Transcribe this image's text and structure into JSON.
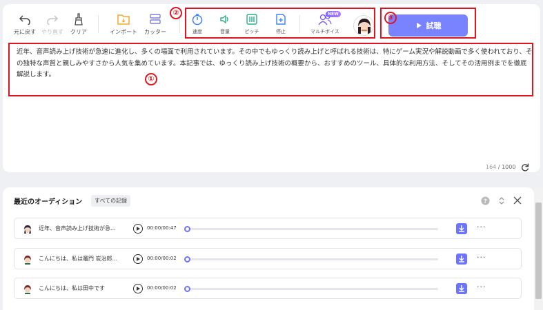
{
  "toolbar": {
    "undo": "元に戻す",
    "redo": "やり直す",
    "clear": "クリア",
    "import": "インポート",
    "cutter": "カッター",
    "speed": "速度",
    "volume": "音量",
    "pitch": "ピッチ",
    "pause": "停止",
    "multi_voice": "マルチボイス",
    "new_badge": "NEW",
    "try_button": "試聴"
  },
  "editor": {
    "text": "近年、音声読み上げ技術が急速に進化し、多くの場面で利用されています。その中でもゆっくり読み上げと呼ばれる技術は、特にゲーム実況や解説動画で多く使われており、その独特な声質と親しみやすさから人気を集めています。本記事では、ゆっくり読み上げ技術の概要から、おすすめのツール、具体的な利用方法、そしてその活用例までを徹底解説します。",
    "count": "164",
    "max": " / 1000"
  },
  "annotations": [
    "②",
    "③",
    "①",
    "④"
  ],
  "recent": {
    "title": "最近のオーディション",
    "all_records": "すべての記録",
    "rows": [
      {
        "text": "近年、音声読み上げ技術が急...",
        "time": "00:00/00:47",
        "progress": 0
      },
      {
        "text": "こんにちは、私は竈門 炭治郎...",
        "time": "00:00/00:02",
        "progress": 0
      },
      {
        "text": "こんにちは、私は田中です",
        "time": "00:00/00:02",
        "progress": 0
      }
    ]
  },
  "colors": {
    "accent": "#6b73ff",
    "annotation": "#e0141e",
    "import_icon": "#f5a623",
    "speed_icon": "#3b82f6",
    "volume_icon": "#22b07d",
    "pitch_icon": "#22b07d",
    "pause_icon": "#3b82f6",
    "multi_voice_icon": "#7c5cff"
  },
  "icons": [
    "undo-icon",
    "redo-icon",
    "broom-icon",
    "folder-import-icon",
    "cutter-icon",
    "speed-icon",
    "volume-icon",
    "pitch-icon",
    "pause-insert-icon",
    "multi-voice-icon",
    "avatar",
    "play-icon",
    "help-icon",
    "sort-icon",
    "close-icon",
    "download-icon",
    "more-icon",
    "refresh-icon"
  ]
}
